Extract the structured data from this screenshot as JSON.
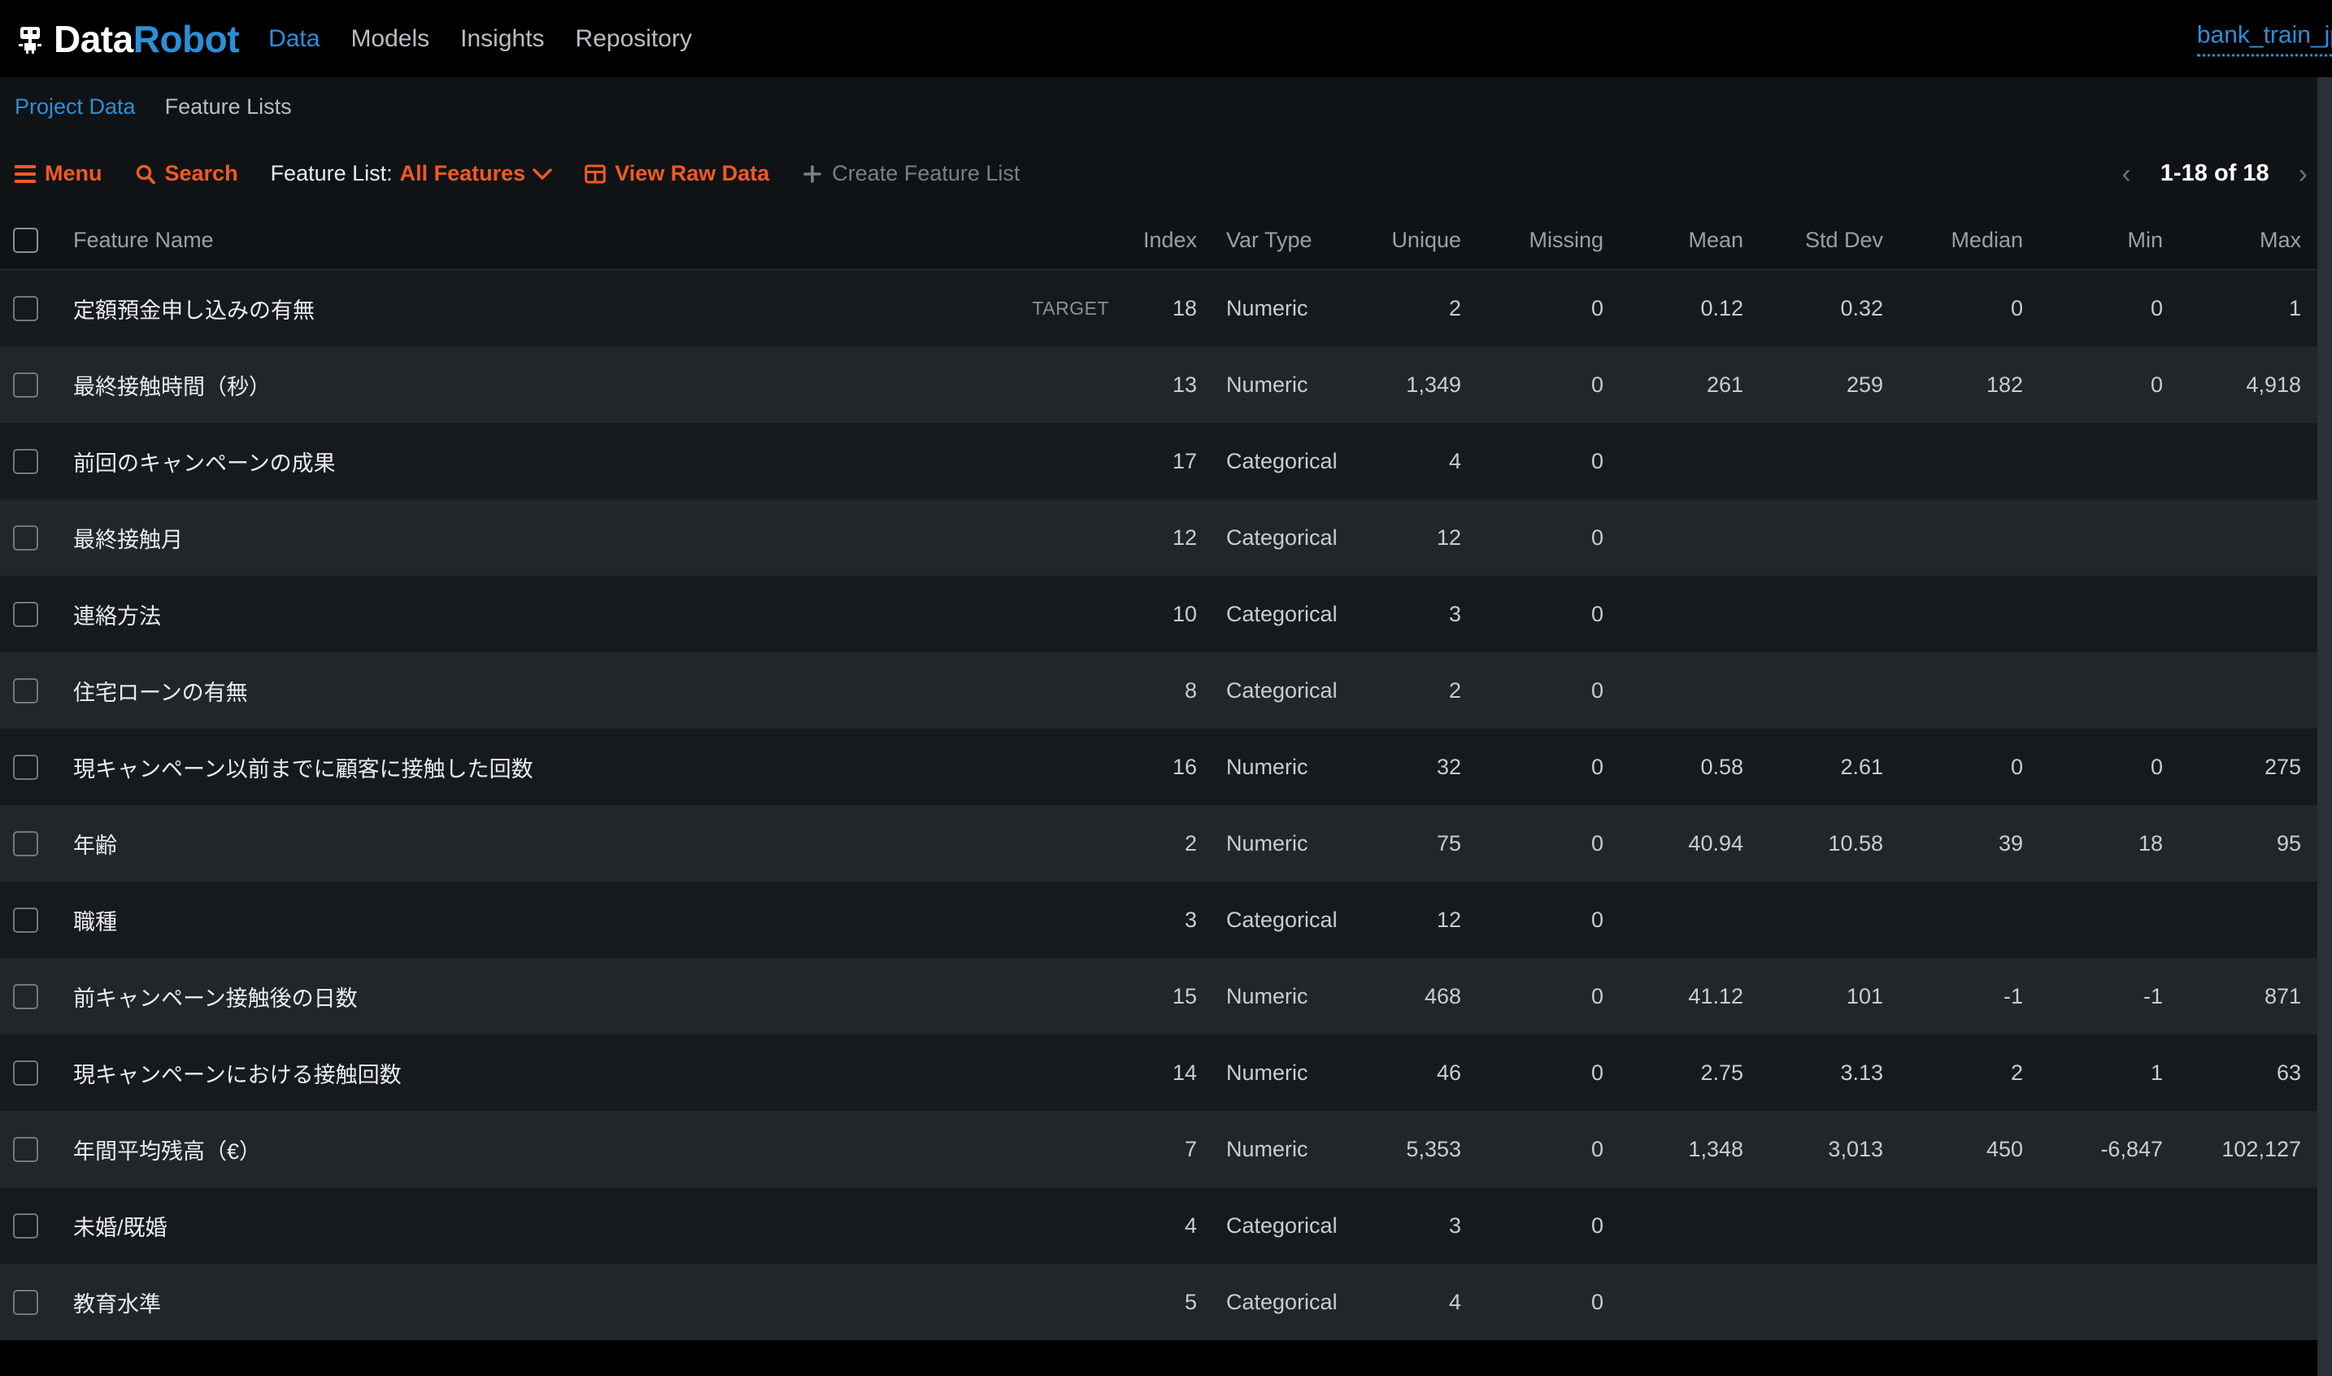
{
  "brand": {
    "icon": "robot-icon",
    "name_part1": "Data",
    "name_part2": "Robot"
  },
  "topnav": {
    "items": [
      {
        "label": "Data",
        "active": true
      },
      {
        "label": "Models",
        "active": false
      },
      {
        "label": "Insights",
        "active": false
      },
      {
        "label": "Repository",
        "active": false
      }
    ],
    "project_name": "bank_train_jp"
  },
  "subnav": {
    "items": [
      {
        "label": "Project Data",
        "active": true
      },
      {
        "label": "Feature Lists",
        "active": false
      }
    ]
  },
  "toolbar": {
    "menu_label": "Menu",
    "search_label": "Search",
    "feature_list_prefix": "Feature List:",
    "feature_list_value": "All Features",
    "view_raw_data_label": "View Raw Data",
    "create_feature_list_label": "Create Feature List",
    "pagination": {
      "prev_icon": "chevron-left-icon",
      "label": "1-18 of 18",
      "next_icon": "chevron-right-icon"
    }
  },
  "colors": {
    "accent": "#f15a22",
    "link": "#2a8fd8",
    "page_bg": "#000000",
    "panel_bg": "#101316",
    "row_odd": "#16191d",
    "row_even": "#22262b"
  },
  "table": {
    "columns": [
      "Feature Name",
      "Index",
      "Var Type",
      "Unique",
      "Missing",
      "Mean",
      "Std Dev",
      "Median",
      "Min",
      "Max"
    ],
    "target_badge": "TARGET",
    "rows": [
      {
        "name": "定額預金申し込みの有無",
        "target": "TARGET",
        "index": "18",
        "var_type": "Numeric",
        "unique": "2",
        "missing": "0",
        "mean": "0.12",
        "std_dev": "0.32",
        "median": "0",
        "min": "0",
        "max": "1"
      },
      {
        "name": "最終接触時間（秒）",
        "target": "",
        "index": "13",
        "var_type": "Numeric",
        "unique": "1,349",
        "missing": "0",
        "mean": "261",
        "std_dev": "259",
        "median": "182",
        "min": "0",
        "max": "4,918"
      },
      {
        "name": "前回のキャンペーンの成果",
        "target": "",
        "index": "17",
        "var_type": "Categorical",
        "unique": "4",
        "missing": "0",
        "mean": "",
        "std_dev": "",
        "median": "",
        "min": "",
        "max": ""
      },
      {
        "name": "最終接触月",
        "target": "",
        "index": "12",
        "var_type": "Categorical",
        "unique": "12",
        "missing": "0",
        "mean": "",
        "std_dev": "",
        "median": "",
        "min": "",
        "max": ""
      },
      {
        "name": "連絡方法",
        "target": "",
        "index": "10",
        "var_type": "Categorical",
        "unique": "3",
        "missing": "0",
        "mean": "",
        "std_dev": "",
        "median": "",
        "min": "",
        "max": ""
      },
      {
        "name": "住宅ローンの有無",
        "target": "",
        "index": "8",
        "var_type": "Categorical",
        "unique": "2",
        "missing": "0",
        "mean": "",
        "std_dev": "",
        "median": "",
        "min": "",
        "max": ""
      },
      {
        "name": "現キャンペーン以前までに顧客に接触した回数",
        "target": "",
        "index": "16",
        "var_type": "Numeric",
        "unique": "32",
        "missing": "0",
        "mean": "0.58",
        "std_dev": "2.61",
        "median": "0",
        "min": "0",
        "max": "275"
      },
      {
        "name": "年齢",
        "target": "",
        "index": "2",
        "var_type": "Numeric",
        "unique": "75",
        "missing": "0",
        "mean": "40.94",
        "std_dev": "10.58",
        "median": "39",
        "min": "18",
        "max": "95"
      },
      {
        "name": "職種",
        "target": "",
        "index": "3",
        "var_type": "Categorical",
        "unique": "12",
        "missing": "0",
        "mean": "",
        "std_dev": "",
        "median": "",
        "min": "",
        "max": ""
      },
      {
        "name": "前キャンペーン接触後の日数",
        "target": "",
        "index": "15",
        "var_type": "Numeric",
        "unique": "468",
        "missing": "0",
        "mean": "41.12",
        "std_dev": "101",
        "median": "-1",
        "min": "-1",
        "max": "871"
      },
      {
        "name": "現キャンペーンにおける接触回数",
        "target": "",
        "index": "14",
        "var_type": "Numeric",
        "unique": "46",
        "missing": "0",
        "mean": "2.75",
        "std_dev": "3.13",
        "median": "2",
        "min": "1",
        "max": "63"
      },
      {
        "name": "年間平均残高（€）",
        "target": "",
        "index": "7",
        "var_type": "Numeric",
        "unique": "5,353",
        "missing": "0",
        "mean": "1,348",
        "std_dev": "3,013",
        "median": "450",
        "min": "-6,847",
        "max": "102,127"
      },
      {
        "name": "未婚/既婚",
        "target": "",
        "index": "4",
        "var_type": "Categorical",
        "unique": "3",
        "missing": "0",
        "mean": "",
        "std_dev": "",
        "median": "",
        "min": "",
        "max": ""
      },
      {
        "name": "教育水準",
        "target": "",
        "index": "5",
        "var_type": "Categorical",
        "unique": "4",
        "missing": "0",
        "mean": "",
        "std_dev": "",
        "median": "",
        "min": "",
        "max": ""
      }
    ]
  }
}
